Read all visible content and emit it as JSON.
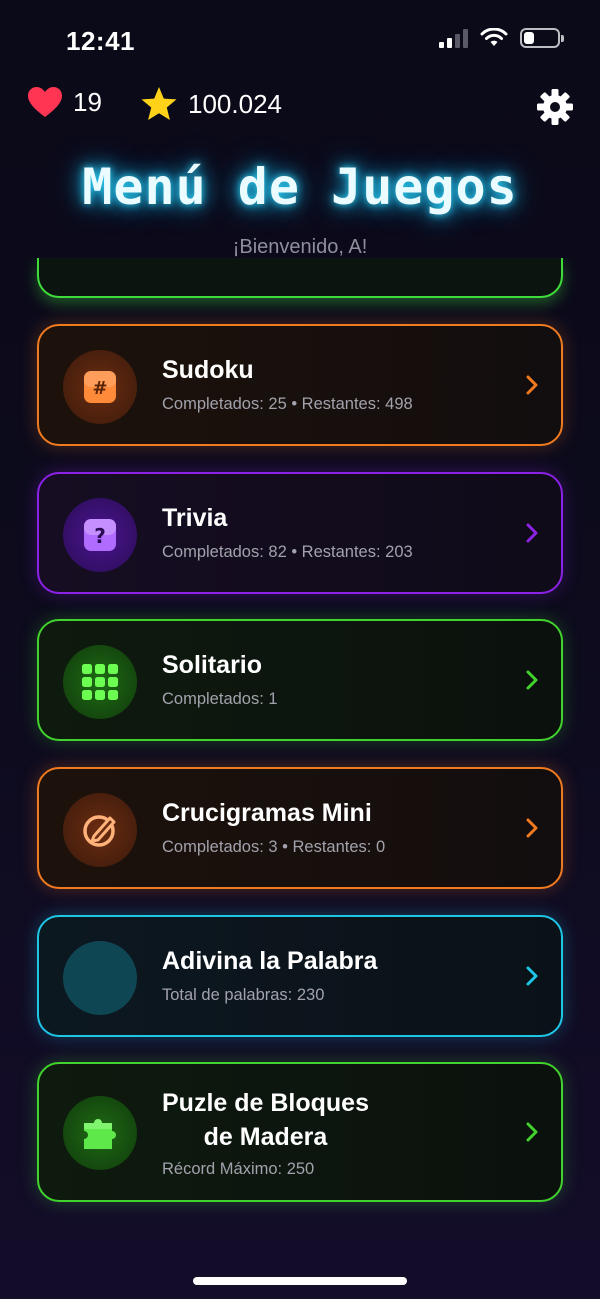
{
  "status_bar": {
    "time": "12:41"
  },
  "header": {
    "lives": "19",
    "coins": "100.024",
    "title": "Menú de Juegos",
    "subtitle": "¡Bienvenido, A!"
  },
  "games": [
    {
      "name": "Sudoku",
      "stats": "Completados: 25 • Restantes: 498",
      "icon": "sudoku-hash-icon",
      "accent": "#f07a1f"
    },
    {
      "name": "Trivia",
      "stats": "Completados: 82 • Restantes: 203",
      "icon": "question-icon",
      "accent": "#8b22e6"
    },
    {
      "name": "Solitario",
      "stats": "Completados: 1",
      "icon": "grid-icon",
      "accent": "#42d22e"
    },
    {
      "name": "Crucigramas Mini",
      "stats": "Completados: 3 • Restantes: 0",
      "icon": "pencil-circle-icon",
      "accent": "#f07a1f"
    },
    {
      "name": "Adivina la Palabra",
      "stats": "Total de palabras: 230",
      "icon": "empty-circle",
      "accent": "#1ec6e6"
    },
    {
      "name": "Puzle de Bloques\nde Madera",
      "name_line1": "Puzle de Bloques",
      "name_line2": "de Madera",
      "stats": "Récord Máximo: 250",
      "icon": "puzzle-icon",
      "accent": "#42d22e"
    }
  ]
}
